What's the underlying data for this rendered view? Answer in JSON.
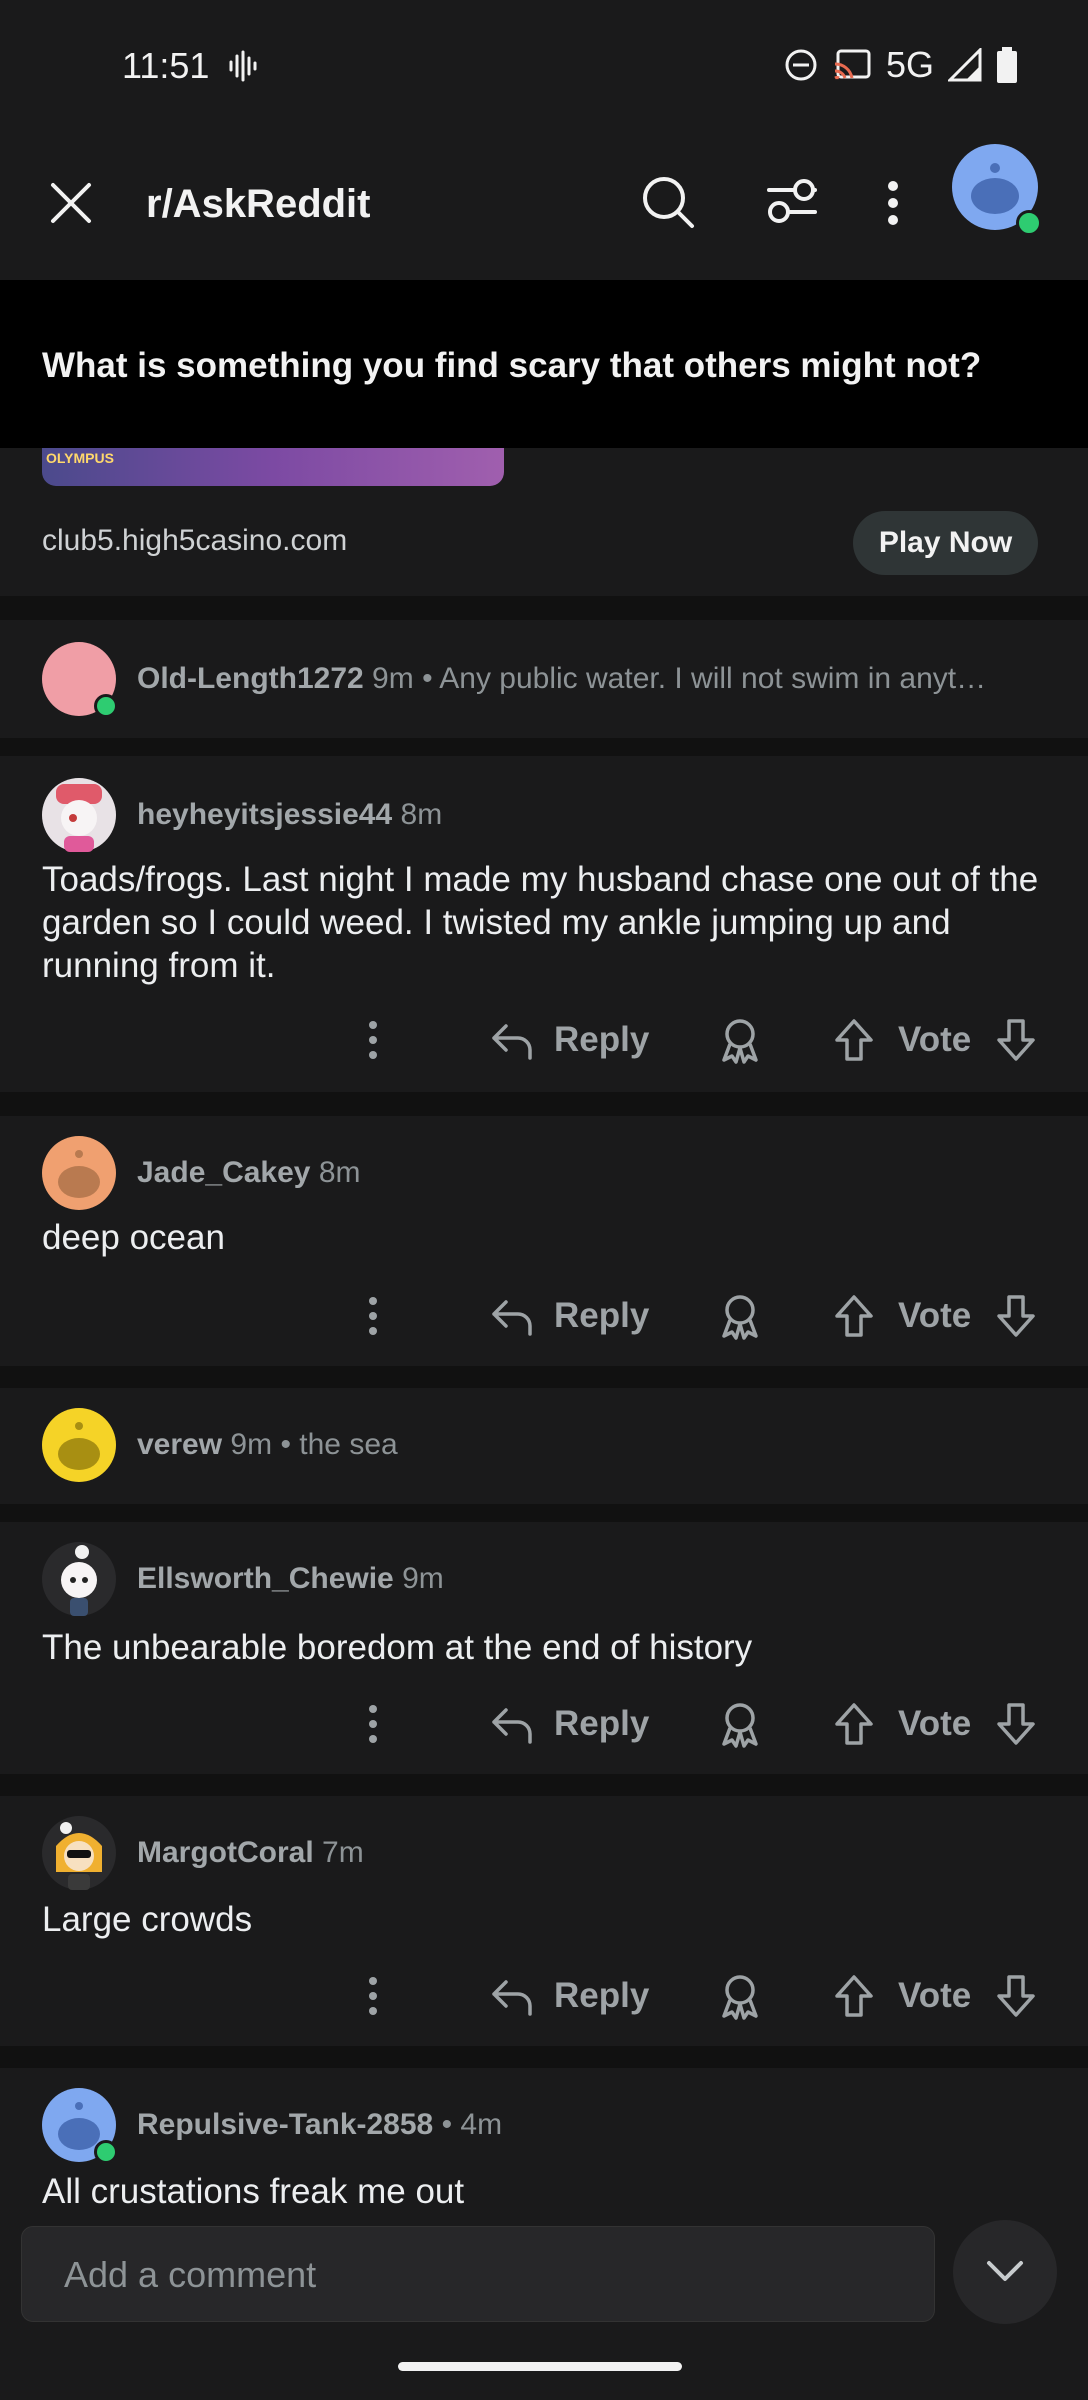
{
  "status_bar": {
    "time": "11:51",
    "network": "5G"
  },
  "header": {
    "title": "r/AskReddit"
  },
  "post": {
    "title": "What is something you find scary that others might not?"
  },
  "ad": {
    "image_text": "OLYMPUS",
    "domain": "club5.high5casino.com",
    "cta": "Play Now"
  },
  "actions": {
    "reply": "Reply",
    "vote": "Vote"
  },
  "comments": [
    {
      "user": "Old-Length1272",
      "time": "9m",
      "preview": "• Any public water. I will not swim in anyt…"
    },
    {
      "user": "heyheyitsjessie44",
      "time": "8m",
      "body": "Toads/frogs.  Last night I made my husband chase one out of the garden so I could weed.  I twisted my ankle jumping up and running from it."
    },
    {
      "user": "Jade_Cakey",
      "time": "8m",
      "body": "deep ocean"
    },
    {
      "user": "verew",
      "time": "9m",
      "preview": "• the sea"
    },
    {
      "user": "Ellsworth_Chewie",
      "time": "9m",
      "body": "The unbearable boredom at the end of history"
    },
    {
      "user": "MargotCoral",
      "time": "7m",
      "body": "Large crowds"
    },
    {
      "user": "Repulsive-Tank-2858",
      "time": "• 4m",
      "body": "All crustations freak me out"
    }
  ],
  "composer": {
    "placeholder": "Add a comment"
  },
  "colors": {
    "online": "#2ecc71",
    "background": "#1a1a1b"
  }
}
